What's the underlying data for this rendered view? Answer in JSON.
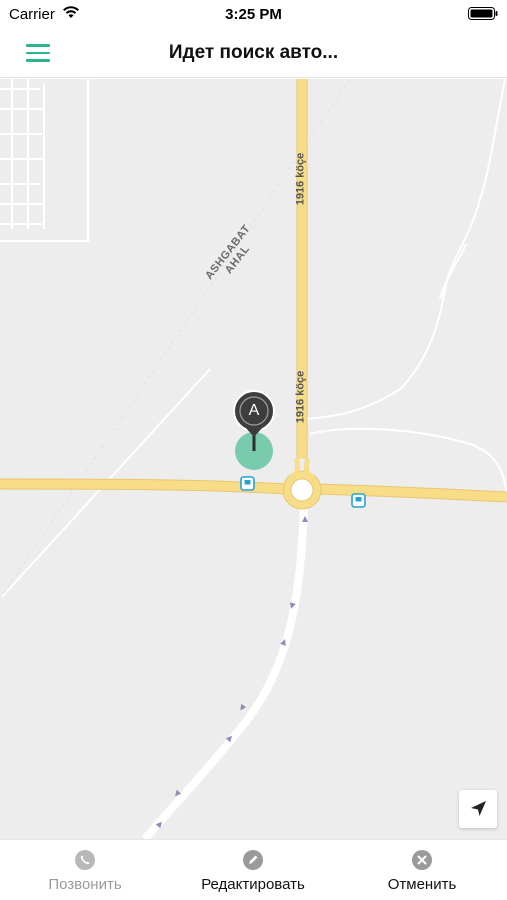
{
  "status_bar": {
    "carrier": "Carrier",
    "time": "3:25 PM"
  },
  "nav": {
    "title": "Идет поиск авто...",
    "menu_icon": "hamburger-menu-icon",
    "accent_color": "#2bb58c"
  },
  "map": {
    "road_labels": [
      "1916 köçe",
      "1916 köçe"
    ],
    "district_label": [
      "ASHGABAT",
      "AHAL"
    ],
    "marker_label": "A",
    "marker_color": "#3d3d3d",
    "position_circle_color": "#6cc7a6",
    "road_color": "#f7dd88",
    "locate_icon": "navigation-arrow-icon"
  },
  "actions": {
    "call": {
      "label": "Позвонить",
      "icon": "phone-icon",
      "enabled": false
    },
    "edit": {
      "label": "Редактировать",
      "icon": "pencil-icon",
      "enabled": true
    },
    "cancel": {
      "label": "Отменить",
      "icon": "close-circle-icon",
      "enabled": true
    }
  }
}
